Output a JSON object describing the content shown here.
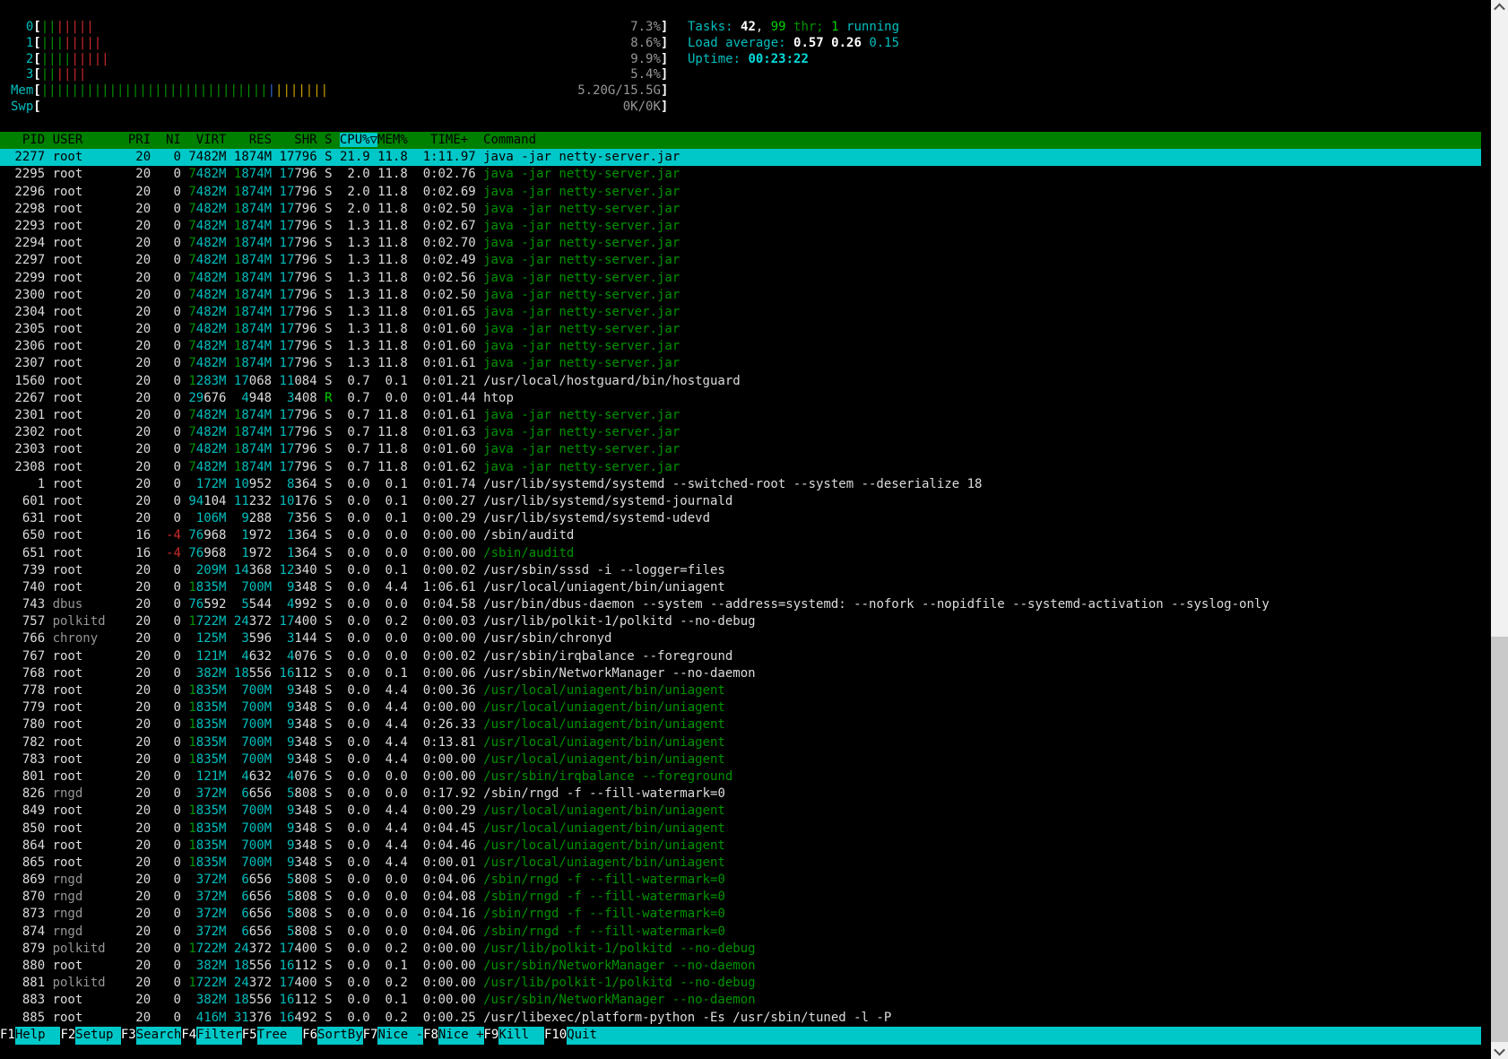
{
  "colors": {
    "accent_cyan": "#00c8c8",
    "bright_cyan": "#00dcdc",
    "header_green": "#008000",
    "text_green": "#009300",
    "bright_green": "#00d300",
    "text_cyan": "#00bebe",
    "text_white": "#dcdcdc",
    "gray": "#969696",
    "red": "#cc2a2a",
    "meter_blue": "#3465cf",
    "meter_yellow": "#c9a200"
  },
  "meters": {
    "inner_width": 82,
    "cpus": [
      {
        "label": "0",
        "value": "7.3%",
        "green": 2,
        "red": 5
      },
      {
        "label": "1",
        "value": "8.6%",
        "green": 3,
        "red": 5
      },
      {
        "label": "2",
        "value": "9.9%",
        "green": 4,
        "red": 5
      },
      {
        "label": "3",
        "value": "5.4%",
        "green": 2,
        "red": 4
      }
    ],
    "mem": {
      "label": "Mem",
      "value": "5.20G/15.5G",
      "green": 30,
      "blue": 1,
      "yellow": 7
    },
    "swp": {
      "label": "Swp",
      "value": "0K/0K"
    }
  },
  "summary": {
    "tasks": {
      "label": "Tasks: ",
      "count": "42",
      "sep": ", ",
      "threads": "99",
      "thr_label": " thr; ",
      "running_count": "1",
      "running_label": " running"
    },
    "load": {
      "label": "Load average: ",
      "one": "0.57",
      "five": "0.26",
      "fifteen": "0.15"
    },
    "uptime": {
      "label": "Uptime: ",
      "value": "00:23:22"
    }
  },
  "table": {
    "header": {
      "pid": "PID",
      "user": "USER",
      "pri": "PRI",
      "ni": "NI",
      "virt": "VIRT",
      "res": "RES",
      "shr": "SHR",
      "s": "S",
      "cpu": "CPU%",
      "sort_arrow": "▽",
      "mem": "MEM%",
      "time": "TIME+",
      "command": "Command",
      "sort_column": "CPU%"
    },
    "rows": [
      {
        "pid": "2277",
        "user": "root",
        "pri": "20",
        "ni": "0",
        "virt": "7482M",
        "res": "1874M",
        "shr": "17796",
        "s": "S",
        "cpu": "21.9",
        "mem": "11.8",
        "time": "1:11.97",
        "cmd": "java -jar netty-server.jar",
        "sel": true
      },
      {
        "pid": "2295",
        "user": "root",
        "pri": "20",
        "ni": "0",
        "virt": "7482M",
        "res": "1874M",
        "shr": "17796",
        "s": "S",
        "cpu": "2.0",
        "mem": "11.8",
        "time": "0:02.76",
        "cmd": "java -jar netty-server.jar",
        "cg": true
      },
      {
        "pid": "2296",
        "user": "root",
        "pri": "20",
        "ni": "0",
        "virt": "7482M",
        "res": "1874M",
        "shr": "17796",
        "s": "S",
        "cpu": "2.0",
        "mem": "11.8",
        "time": "0:02.69",
        "cmd": "java -jar netty-server.jar",
        "cg": true
      },
      {
        "pid": "2298",
        "user": "root",
        "pri": "20",
        "ni": "0",
        "virt": "7482M",
        "res": "1874M",
        "shr": "17796",
        "s": "S",
        "cpu": "2.0",
        "mem": "11.8",
        "time": "0:02.50",
        "cmd": "java -jar netty-server.jar",
        "cg": true
      },
      {
        "pid": "2293",
        "user": "root",
        "pri": "20",
        "ni": "0",
        "virt": "7482M",
        "res": "1874M",
        "shr": "17796",
        "s": "S",
        "cpu": "1.3",
        "mem": "11.8",
        "time": "0:02.67",
        "cmd": "java -jar netty-server.jar",
        "cg": true
      },
      {
        "pid": "2294",
        "user": "root",
        "pri": "20",
        "ni": "0",
        "virt": "7482M",
        "res": "1874M",
        "shr": "17796",
        "s": "S",
        "cpu": "1.3",
        "mem": "11.8",
        "time": "0:02.70",
        "cmd": "java -jar netty-server.jar",
        "cg": true
      },
      {
        "pid": "2297",
        "user": "root",
        "pri": "20",
        "ni": "0",
        "virt": "7482M",
        "res": "1874M",
        "shr": "17796",
        "s": "S",
        "cpu": "1.3",
        "mem": "11.8",
        "time": "0:02.49",
        "cmd": "java -jar netty-server.jar",
        "cg": true
      },
      {
        "pid": "2299",
        "user": "root",
        "pri": "20",
        "ni": "0",
        "virt": "7482M",
        "res": "1874M",
        "shr": "17796",
        "s": "S",
        "cpu": "1.3",
        "mem": "11.8",
        "time": "0:02.56",
        "cmd": "java -jar netty-server.jar",
        "cg": true
      },
      {
        "pid": "2300",
        "user": "root",
        "pri": "20",
        "ni": "0",
        "virt": "7482M",
        "res": "1874M",
        "shr": "17796",
        "s": "S",
        "cpu": "1.3",
        "mem": "11.8",
        "time": "0:02.50",
        "cmd": "java -jar netty-server.jar",
        "cg": true
      },
      {
        "pid": "2304",
        "user": "root",
        "pri": "20",
        "ni": "0",
        "virt": "7482M",
        "res": "1874M",
        "shr": "17796",
        "s": "S",
        "cpu": "1.3",
        "mem": "11.8",
        "time": "0:01.65",
        "cmd": "java -jar netty-server.jar",
        "cg": true
      },
      {
        "pid": "2305",
        "user": "root",
        "pri": "20",
        "ni": "0",
        "virt": "7482M",
        "res": "1874M",
        "shr": "17796",
        "s": "S",
        "cpu": "1.3",
        "mem": "11.8",
        "time": "0:01.60",
        "cmd": "java -jar netty-server.jar",
        "cg": true
      },
      {
        "pid": "2306",
        "user": "root",
        "pri": "20",
        "ni": "0",
        "virt": "7482M",
        "res": "1874M",
        "shr": "17796",
        "s": "S",
        "cpu": "1.3",
        "mem": "11.8",
        "time": "0:01.60",
        "cmd": "java -jar netty-server.jar",
        "cg": true
      },
      {
        "pid": "2307",
        "user": "root",
        "pri": "20",
        "ni": "0",
        "virt": "7482M",
        "res": "1874M",
        "shr": "17796",
        "s": "S",
        "cpu": "1.3",
        "mem": "11.8",
        "time": "0:01.61",
        "cmd": "java -jar netty-server.jar",
        "cg": true
      },
      {
        "pid": "1560",
        "user": "root",
        "pri": "20",
        "ni": "0",
        "virt": "1283M",
        "res": "17068",
        "shr": "11084",
        "s": "S",
        "cpu": "0.7",
        "mem": "0.1",
        "time": "0:01.21",
        "cmd": "/usr/local/hostguard/bin/hostguard"
      },
      {
        "pid": "2267",
        "user": "root",
        "pri": "20",
        "ni": "0",
        "virt": "29676",
        "res": "4948",
        "shr": "3408",
        "s": "R",
        "cpu": "0.7",
        "mem": "0.0",
        "time": "0:01.44",
        "cmd": "htop"
      },
      {
        "pid": "2301",
        "user": "root",
        "pri": "20",
        "ni": "0",
        "virt": "7482M",
        "res": "1874M",
        "shr": "17796",
        "s": "S",
        "cpu": "0.7",
        "mem": "11.8",
        "time": "0:01.61",
        "cmd": "java -jar netty-server.jar",
        "cg": true
      },
      {
        "pid": "2302",
        "user": "root",
        "pri": "20",
        "ni": "0",
        "virt": "7482M",
        "res": "1874M",
        "shr": "17796",
        "s": "S",
        "cpu": "0.7",
        "mem": "11.8",
        "time": "0:01.63",
        "cmd": "java -jar netty-server.jar",
        "cg": true
      },
      {
        "pid": "2303",
        "user": "root",
        "pri": "20",
        "ni": "0",
        "virt": "7482M",
        "res": "1874M",
        "shr": "17796",
        "s": "S",
        "cpu": "0.7",
        "mem": "11.8",
        "time": "0:01.60",
        "cmd": "java -jar netty-server.jar",
        "cg": true
      },
      {
        "pid": "2308",
        "user": "root",
        "pri": "20",
        "ni": "0",
        "virt": "7482M",
        "res": "1874M",
        "shr": "17796",
        "s": "S",
        "cpu": "0.7",
        "mem": "11.8",
        "time": "0:01.62",
        "cmd": "java -jar netty-server.jar",
        "cg": true
      },
      {
        "pid": "1",
        "user": "root",
        "pri": "20",
        "ni": "0",
        "virt": "172M",
        "res": "10952",
        "shr": "8364",
        "s": "S",
        "cpu": "0.0",
        "mem": "0.1",
        "time": "0:01.74",
        "cmd": "/usr/lib/systemd/systemd --switched-root --system --deserialize 18"
      },
      {
        "pid": "601",
        "user": "root",
        "pri": "20",
        "ni": "0",
        "virt": "94104",
        "res": "11232",
        "shr": "10176",
        "s": "S",
        "cpu": "0.0",
        "mem": "0.1",
        "time": "0:00.27",
        "cmd": "/usr/lib/systemd/systemd-journald"
      },
      {
        "pid": "631",
        "user": "root",
        "pri": "20",
        "ni": "0",
        "virt": "106M",
        "res": "9288",
        "shr": "7356",
        "s": "S",
        "cpu": "0.0",
        "mem": "0.1",
        "time": "0:00.29",
        "cmd": "/usr/lib/systemd/systemd-udevd"
      },
      {
        "pid": "650",
        "user": "root",
        "pri": "16",
        "ni": "-4",
        "virt": "76968",
        "res": "1972",
        "shr": "1364",
        "s": "S",
        "cpu": "0.0",
        "mem": "0.0",
        "time": "0:00.00",
        "cmd": "/sbin/auditd"
      },
      {
        "pid": "651",
        "user": "root",
        "pri": "16",
        "ni": "-4",
        "virt": "76968",
        "res": "1972",
        "shr": "1364",
        "s": "S",
        "cpu": "0.0",
        "mem": "0.0",
        "time": "0:00.00",
        "cmd": "/sbin/auditd",
        "cg": true
      },
      {
        "pid": "739",
        "user": "root",
        "pri": "20",
        "ni": "0",
        "virt": "209M",
        "res": "14368",
        "shr": "12340",
        "s": "S",
        "cpu": "0.0",
        "mem": "0.1",
        "time": "0:00.02",
        "cmd": "/usr/sbin/sssd -i --logger=files"
      },
      {
        "pid": "740",
        "user": "root",
        "pri": "20",
        "ni": "0",
        "virt": "1835M",
        "res": "700M",
        "shr": "9348",
        "s": "S",
        "cpu": "0.0",
        "mem": "4.4",
        "time": "1:06.61",
        "cmd": "/usr/local/uniagent/bin/uniagent"
      },
      {
        "pid": "743",
        "user": "dbus",
        "pri": "20",
        "ni": "0",
        "virt": "76592",
        "res": "5544",
        "shr": "4992",
        "s": "S",
        "cpu": "0.0",
        "mem": "0.0",
        "time": "0:04.58",
        "cmd": "/usr/bin/dbus-daemon --system --address=systemd: --nofork --nopidfile --systemd-activation --syslog-only"
      },
      {
        "pid": "757",
        "user": "polkitd",
        "pri": "20",
        "ni": "0",
        "virt": "1722M",
        "res": "24372",
        "shr": "17400",
        "s": "S",
        "cpu": "0.0",
        "mem": "0.2",
        "time": "0:00.03",
        "cmd": "/usr/lib/polkit-1/polkitd --no-debug"
      },
      {
        "pid": "766",
        "user": "chrony",
        "pri": "20",
        "ni": "0",
        "virt": "125M",
        "res": "3596",
        "shr": "3144",
        "s": "S",
        "cpu": "0.0",
        "mem": "0.0",
        "time": "0:00.00",
        "cmd": "/usr/sbin/chronyd"
      },
      {
        "pid": "767",
        "user": "root",
        "pri": "20",
        "ni": "0",
        "virt": "121M",
        "res": "4632",
        "shr": "4076",
        "s": "S",
        "cpu": "0.0",
        "mem": "0.0",
        "time": "0:00.02",
        "cmd": "/usr/sbin/irqbalance --foreground"
      },
      {
        "pid": "768",
        "user": "root",
        "pri": "20",
        "ni": "0",
        "virt": "382M",
        "res": "18556",
        "shr": "16112",
        "s": "S",
        "cpu": "0.0",
        "mem": "0.1",
        "time": "0:00.06",
        "cmd": "/usr/sbin/NetworkManager --no-daemon"
      },
      {
        "pid": "778",
        "user": "root",
        "pri": "20",
        "ni": "0",
        "virt": "1835M",
        "res": "700M",
        "shr": "9348",
        "s": "S",
        "cpu": "0.0",
        "mem": "4.4",
        "time": "0:00.36",
        "cmd": "/usr/local/uniagent/bin/uniagent",
        "cg": true
      },
      {
        "pid": "779",
        "user": "root",
        "pri": "20",
        "ni": "0",
        "virt": "1835M",
        "res": "700M",
        "shr": "9348",
        "s": "S",
        "cpu": "0.0",
        "mem": "4.4",
        "time": "0:00.00",
        "cmd": "/usr/local/uniagent/bin/uniagent",
        "cg": true
      },
      {
        "pid": "780",
        "user": "root",
        "pri": "20",
        "ni": "0",
        "virt": "1835M",
        "res": "700M",
        "shr": "9348",
        "s": "S",
        "cpu": "0.0",
        "mem": "4.4",
        "time": "0:26.33",
        "cmd": "/usr/local/uniagent/bin/uniagent",
        "cg": true
      },
      {
        "pid": "782",
        "user": "root",
        "pri": "20",
        "ni": "0",
        "virt": "1835M",
        "res": "700M",
        "shr": "9348",
        "s": "S",
        "cpu": "0.0",
        "mem": "4.4",
        "time": "0:13.81",
        "cmd": "/usr/local/uniagent/bin/uniagent",
        "cg": true
      },
      {
        "pid": "783",
        "user": "root",
        "pri": "20",
        "ni": "0",
        "virt": "1835M",
        "res": "700M",
        "shr": "9348",
        "s": "S",
        "cpu": "0.0",
        "mem": "4.4",
        "time": "0:00.00",
        "cmd": "/usr/local/uniagent/bin/uniagent",
        "cg": true
      },
      {
        "pid": "801",
        "user": "root",
        "pri": "20",
        "ni": "0",
        "virt": "121M",
        "res": "4632",
        "shr": "4076",
        "s": "S",
        "cpu": "0.0",
        "mem": "0.0",
        "time": "0:00.00",
        "cmd": "/usr/sbin/irqbalance --foreground",
        "cg": true
      },
      {
        "pid": "826",
        "user": "rngd",
        "pri": "20",
        "ni": "0",
        "virt": "372M",
        "res": "6656",
        "shr": "5808",
        "s": "S",
        "cpu": "0.0",
        "mem": "0.0",
        "time": "0:17.92",
        "cmd": "/sbin/rngd -f --fill-watermark=0"
      },
      {
        "pid": "849",
        "user": "root",
        "pri": "20",
        "ni": "0",
        "virt": "1835M",
        "res": "700M",
        "shr": "9348",
        "s": "S",
        "cpu": "0.0",
        "mem": "4.4",
        "time": "0:00.29",
        "cmd": "/usr/local/uniagent/bin/uniagent",
        "cg": true
      },
      {
        "pid": "850",
        "user": "root",
        "pri": "20",
        "ni": "0",
        "virt": "1835M",
        "res": "700M",
        "shr": "9348",
        "s": "S",
        "cpu": "0.0",
        "mem": "4.4",
        "time": "0:04.45",
        "cmd": "/usr/local/uniagent/bin/uniagent",
        "cg": true
      },
      {
        "pid": "864",
        "user": "root",
        "pri": "20",
        "ni": "0",
        "virt": "1835M",
        "res": "700M",
        "shr": "9348",
        "s": "S",
        "cpu": "0.0",
        "mem": "4.4",
        "time": "0:04.46",
        "cmd": "/usr/local/uniagent/bin/uniagent",
        "cg": true
      },
      {
        "pid": "865",
        "user": "root",
        "pri": "20",
        "ni": "0",
        "virt": "1835M",
        "res": "700M",
        "shr": "9348",
        "s": "S",
        "cpu": "0.0",
        "mem": "4.4",
        "time": "0:00.01",
        "cmd": "/usr/local/uniagent/bin/uniagent",
        "cg": true
      },
      {
        "pid": "869",
        "user": "rngd",
        "pri": "20",
        "ni": "0",
        "virt": "372M",
        "res": "6656",
        "shr": "5808",
        "s": "S",
        "cpu": "0.0",
        "mem": "0.0",
        "time": "0:04.06",
        "cmd": "/sbin/rngd -f --fill-watermark=0",
        "cg": true
      },
      {
        "pid": "870",
        "user": "rngd",
        "pri": "20",
        "ni": "0",
        "virt": "372M",
        "res": "6656",
        "shr": "5808",
        "s": "S",
        "cpu": "0.0",
        "mem": "0.0",
        "time": "0:04.08",
        "cmd": "/sbin/rngd -f --fill-watermark=0",
        "cg": true
      },
      {
        "pid": "873",
        "user": "rngd",
        "pri": "20",
        "ni": "0",
        "virt": "372M",
        "res": "6656",
        "shr": "5808",
        "s": "S",
        "cpu": "0.0",
        "mem": "0.0",
        "time": "0:04.16",
        "cmd": "/sbin/rngd -f --fill-watermark=0",
        "cg": true
      },
      {
        "pid": "874",
        "user": "rngd",
        "pri": "20",
        "ni": "0",
        "virt": "372M",
        "res": "6656",
        "shr": "5808",
        "s": "S",
        "cpu": "0.0",
        "mem": "0.0",
        "time": "0:04.06",
        "cmd": "/sbin/rngd -f --fill-watermark=0",
        "cg": true
      },
      {
        "pid": "879",
        "user": "polkitd",
        "pri": "20",
        "ni": "0",
        "virt": "1722M",
        "res": "24372",
        "shr": "17400",
        "s": "S",
        "cpu": "0.0",
        "mem": "0.2",
        "time": "0:00.00",
        "cmd": "/usr/lib/polkit-1/polkitd --no-debug",
        "cg": true
      },
      {
        "pid": "880",
        "user": "root",
        "pri": "20",
        "ni": "0",
        "virt": "382M",
        "res": "18556",
        "shr": "16112",
        "s": "S",
        "cpu": "0.0",
        "mem": "0.1",
        "time": "0:00.00",
        "cmd": "/usr/sbin/NetworkManager --no-daemon",
        "cg": true
      },
      {
        "pid": "881",
        "user": "polkitd",
        "pri": "20",
        "ni": "0",
        "virt": "1722M",
        "res": "24372",
        "shr": "17400",
        "s": "S",
        "cpu": "0.0",
        "mem": "0.2",
        "time": "0:00.00",
        "cmd": "/usr/lib/polkit-1/polkitd --no-debug",
        "cg": true
      },
      {
        "pid": "883",
        "user": "root",
        "pri": "20",
        "ni": "0",
        "virt": "382M",
        "res": "18556",
        "shr": "16112",
        "s": "S",
        "cpu": "0.0",
        "mem": "0.1",
        "time": "0:00.00",
        "cmd": "/usr/sbin/NetworkManager --no-daemon",
        "cg": true
      },
      {
        "pid": "885",
        "user": "root",
        "pri": "20",
        "ni": "0",
        "virt": "416M",
        "res": "31376",
        "shr": "16492",
        "s": "S",
        "cpu": "0.0",
        "mem": "0.2",
        "time": "0:00.25",
        "cmd": "/usr/libexec/platform-python -Es /usr/sbin/tuned -l -P"
      }
    ]
  },
  "fkeys": [
    {
      "key": "F1",
      "label": "Help"
    },
    {
      "key": "F2",
      "label": "Setup"
    },
    {
      "key": "F3",
      "label": "Search"
    },
    {
      "key": "F4",
      "label": "Filter"
    },
    {
      "key": "F5",
      "label": "Tree"
    },
    {
      "key": "F6",
      "label": "SortBy"
    },
    {
      "key": "F7",
      "label": "Nice -"
    },
    {
      "key": "F8",
      "label": "Nice +"
    },
    {
      "key": "F9",
      "label": "Kill"
    },
    {
      "key": "F10",
      "label": "Quit"
    }
  ]
}
